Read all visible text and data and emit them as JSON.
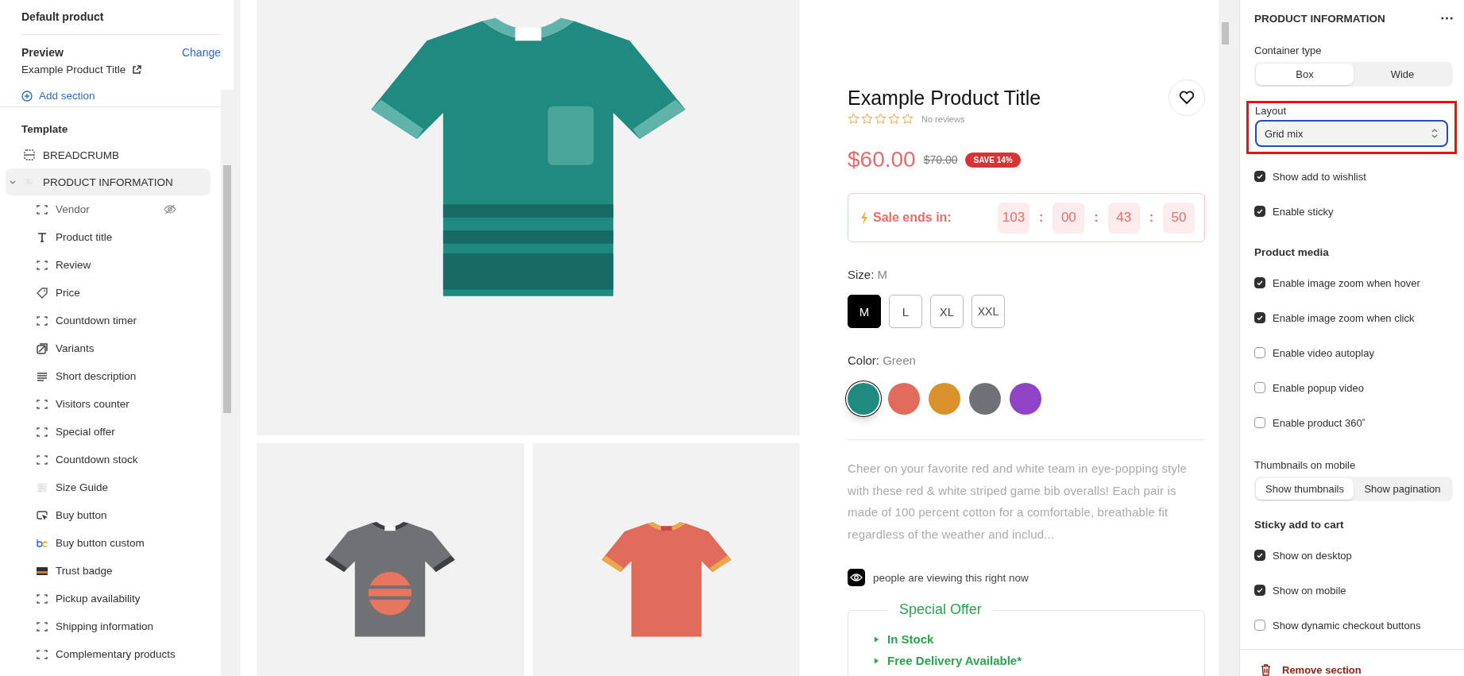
{
  "sidebar": {
    "title": "Default product",
    "preview_label": "Preview",
    "change_link": "Change",
    "preview_product": "Example Product Title",
    "add_section": "Add section",
    "template_heading": "Template",
    "sections": [
      {
        "label": "BREADCRUMB",
        "kind": "rows",
        "selected": false,
        "expanded": false
      },
      {
        "label": "PRODUCT INFORMATION",
        "kind": "image",
        "selected": true,
        "expanded": true,
        "children": [
          {
            "label": "Vendor",
            "kind": "block",
            "hidden": true
          },
          {
            "label": "Product title",
            "kind": "text",
            "hidden": false
          },
          {
            "label": "Review",
            "kind": "block",
            "hidden": false
          },
          {
            "label": "Price",
            "kind": "price",
            "hidden": false
          },
          {
            "label": "Countdown timer",
            "kind": "block",
            "hidden": false
          },
          {
            "label": "Variants",
            "kind": "variants",
            "hidden": false
          },
          {
            "label": "Short description",
            "kind": "lines",
            "hidden": false
          },
          {
            "label": "Visitors counter",
            "kind": "block",
            "hidden": false
          },
          {
            "label": "Special offer",
            "kind": "block",
            "hidden": false
          },
          {
            "label": "Countdown stock",
            "kind": "block",
            "hidden": false
          },
          {
            "label": "Size Guide",
            "kind": "image",
            "hidden": false
          },
          {
            "label": "Buy button",
            "kind": "cursor",
            "hidden": false
          },
          {
            "label": "Buy button custom",
            "kind": "app",
            "hidden": false
          },
          {
            "label": "Trust badge",
            "kind": "badge",
            "hidden": false
          },
          {
            "label": "Pickup availability",
            "kind": "block",
            "hidden": false
          },
          {
            "label": "Shipping information",
            "kind": "block",
            "hidden": false
          },
          {
            "label": "Complementary products",
            "kind": "block",
            "hidden": false
          }
        ]
      }
    ]
  },
  "preview": {
    "gallery": [
      {
        "kind": "pocket",
        "color": "#1f8a80"
      },
      {
        "kind": "sunset",
        "color": "#6f7174"
      },
      {
        "kind": "plain",
        "color": "#e06b5a"
      }
    ],
    "product": {
      "title": "Example Product Title",
      "rating": {
        "stars": 0,
        "text": "No reviews"
      },
      "price": "$60.00",
      "compare_price": "$70.00",
      "badge": "SAVE 14%",
      "countdown": {
        "label": "Sale ends in:",
        "parts": [
          {
            "kind": "unit",
            "text": "103"
          },
          {
            "kind": "sep",
            "text": ":"
          },
          {
            "kind": "unit",
            "text": "00"
          },
          {
            "kind": "sep",
            "text": ":"
          },
          {
            "kind": "unit",
            "text": "43"
          },
          {
            "kind": "sep",
            "text": ":"
          },
          {
            "kind": "unit",
            "text": "50"
          }
        ]
      },
      "size": {
        "label": "Size:",
        "value": "M",
        "options": [
          {
            "label": "M",
            "selected": true
          },
          {
            "label": "L",
            "selected": false
          },
          {
            "label": "XL",
            "selected": false
          },
          {
            "label": "XXL",
            "selected": false
          }
        ]
      },
      "color": {
        "label": "Color:",
        "value": "Green",
        "swatches": [
          {
            "color": "#1f8a80",
            "selected": true
          },
          {
            "color": "#e06b5a",
            "selected": false
          },
          {
            "color": "#d9922c",
            "selected": false
          },
          {
            "color": "#6f7174",
            "selected": false
          },
          {
            "color": "#8e44c4",
            "selected": false
          }
        ]
      },
      "description": "Cheer on your favorite red and white team in eye-popping style with these red & white striped game bib overalls! Each pair is made of 100 percent cotton for a comfortable, breathable fit regardless of the weather and includ...",
      "viewers": "people are viewing this right now",
      "special_offer": {
        "title": "Special Offer",
        "items": [
          "In Stock",
          "Free Delivery Available*"
        ]
      }
    }
  },
  "panel": {
    "title": "PRODUCT INFORMATION",
    "controls": [
      {
        "kind": "segmented",
        "label": "Container type",
        "options": [
          {
            "label": "Box",
            "selected": true
          },
          {
            "label": "Wide",
            "selected": false
          }
        ]
      },
      {
        "kind": "select",
        "label": "Layout",
        "value": "Grid mix",
        "highlighted": true
      },
      {
        "kind": "checkbox",
        "label": "Show add to wishlist",
        "checked": true
      },
      {
        "kind": "checkbox",
        "label": "Enable sticky",
        "checked": true
      },
      {
        "kind": "heading",
        "label": "Product media"
      },
      {
        "kind": "checkbox",
        "label": "Enable image zoom when hover",
        "checked": true
      },
      {
        "kind": "checkbox",
        "label": "Enable image zoom when click",
        "checked": true
      },
      {
        "kind": "checkbox",
        "label": "Enable video autoplay",
        "checked": false
      },
      {
        "kind": "checkbox",
        "label": "Enable popup video",
        "checked": false
      },
      {
        "kind": "checkbox",
        "label": "Enable product 360˚",
        "checked": false
      },
      {
        "kind": "segmented",
        "label": "Thumbnails on mobile",
        "options": [
          {
            "label": "Show thumbnails",
            "selected": true
          },
          {
            "label": "Show pagination",
            "selected": false
          }
        ]
      },
      {
        "kind": "heading",
        "label": "Sticky add to cart"
      },
      {
        "kind": "checkbox",
        "label": "Show on desktop",
        "checked": true
      },
      {
        "kind": "checkbox",
        "label": "Show on mobile",
        "checked": true
      },
      {
        "kind": "checkbox",
        "label": "Show dynamic checkout buttons",
        "checked": false
      }
    ],
    "remove": "Remove section"
  }
}
